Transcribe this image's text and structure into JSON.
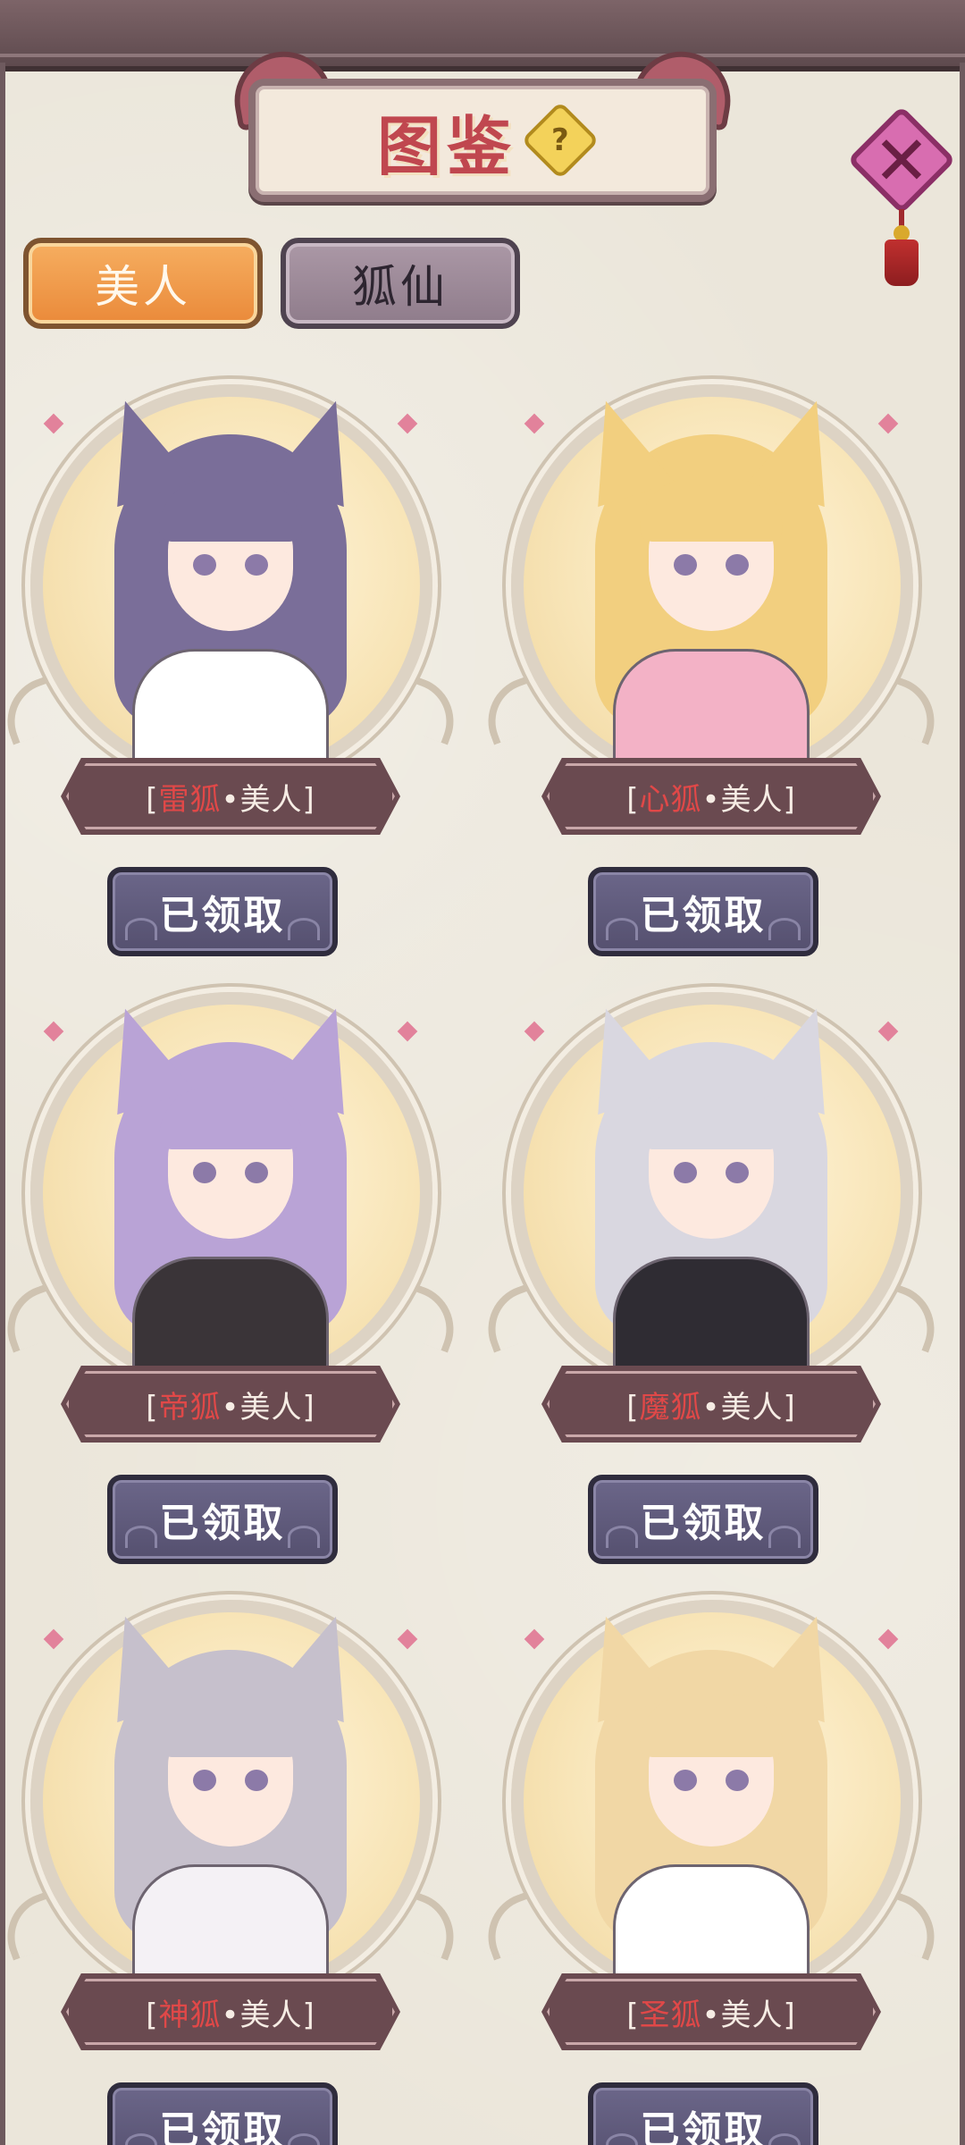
{
  "header": {
    "title": "图鉴",
    "help_symbol": "?",
    "close_symbol": "✕"
  },
  "tabs": [
    {
      "label": "美人",
      "active": true
    },
    {
      "label": "狐仙",
      "active": false
    }
  ],
  "cards": [
    {
      "prefix": "雷狐",
      "suffix": "•美人",
      "button": "已领取",
      "hair": "#7a6e99",
      "outfit": "#ffffff"
    },
    {
      "prefix": "心狐",
      "suffix": "•美人",
      "button": "已领取",
      "hair": "#f2cf7f",
      "outfit": "#f3b2c6"
    },
    {
      "prefix": "帝狐",
      "suffix": "•美人",
      "button": "已领取",
      "hair": "#b9a3d6",
      "outfit": "#3a3438"
    },
    {
      "prefix": "魔狐",
      "suffix": "•美人",
      "button": "已领取",
      "hair": "#d9d7e0",
      "outfit": "#2f2c33"
    },
    {
      "prefix": "神狐",
      "suffix": "•美人",
      "button": "已领取",
      "hair": "#c6c0cc",
      "outfit": "#f4f1f5"
    },
    {
      "prefix": "圣狐",
      "suffix": "•美人",
      "button": "已领取",
      "hair": "#f1d7a5",
      "outfit": "#ffffff"
    }
  ],
  "colors": {
    "prefix_red": "#e04848",
    "active_tab": "#ea8a3a",
    "inactive_tab": "#8f7c8b",
    "claim_button": "#55506f"
  }
}
